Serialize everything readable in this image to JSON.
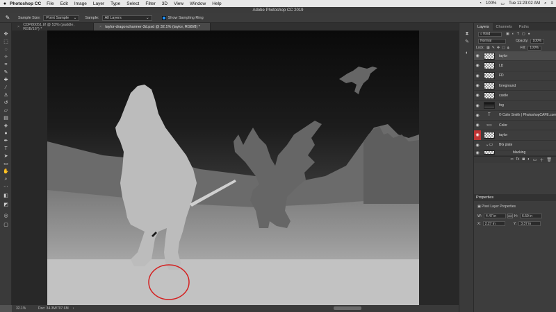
{
  "menubar": {
    "app_name": "Photoshop CC",
    "items": [
      "File",
      "Edit",
      "Image",
      "Layer",
      "Type",
      "Select",
      "Filter",
      "3D",
      "View",
      "Window",
      "Help"
    ],
    "battery": "100%",
    "clock": "Tue 11:23:02 AM"
  },
  "window": {
    "title": "Adobe Photoshop CC 2019"
  },
  "options": {
    "sample_size_label": "Sample Size:",
    "sample_size_value": "Point Sample",
    "sample_label": "Sample:",
    "sample_value": "All Layers",
    "show_ring_label": "Show Sampling Ring"
  },
  "tabs": [
    {
      "label": "CDP80051.tif @ 53% (puddle, RGB/16*) *"
    },
    {
      "label": "taylor-dragoncharmer-3d.psd @ 32.1% (taylor, RGB/8) *"
    }
  ],
  "status": {
    "zoom": "32.1%",
    "doc": "Doc: 34.3M/707.6M"
  },
  "layers_panel": {
    "tabs": [
      "Layers",
      "Channels",
      "Paths"
    ],
    "kind_label": "Kind",
    "blend_mode": "Normal",
    "opacity_label": "Opacity:",
    "opacity_value": "100%",
    "lock_label": "Lock:",
    "fill_label": "Fill:",
    "fill_value": "100%",
    "layers": [
      {
        "name": "taylor",
        "thumb": "trans",
        "selected": true
      },
      {
        "name": "LD",
        "thumb": "trans"
      },
      {
        "name": "FD",
        "thumb": "trans"
      },
      {
        "name": "foreground",
        "thumb": "trans"
      },
      {
        "name": "castle",
        "thumb": "trans"
      },
      {
        "name": "fog",
        "thumb": "dark"
      },
      {
        "name": "© Colin Smith | PhotoshopCAFE.com",
        "thumb": "type"
      },
      {
        "name": "Color",
        "thumb": "folder"
      },
      {
        "name": "taylor",
        "thumb": "trans",
        "eye_red": true
      },
      {
        "name": "BG plate",
        "thumb": "folder"
      },
      {
        "name": "blacking",
        "thumb": "trans"
      }
    ]
  },
  "properties_panel": {
    "title": "Properties",
    "subtitle": "Pixel Layer Properties",
    "w_label": "W:",
    "w_value": "4.47 in",
    "h_label": "H:",
    "h_value": "6.59 in",
    "x_label": "X:",
    "x_value": "2.27 in",
    "y_label": "Y:",
    "y_value": "3.37 in",
    "link_label": "GO"
  },
  "colors": {
    "annotation_ring": "#d42020",
    "highlight": "#c03535"
  }
}
